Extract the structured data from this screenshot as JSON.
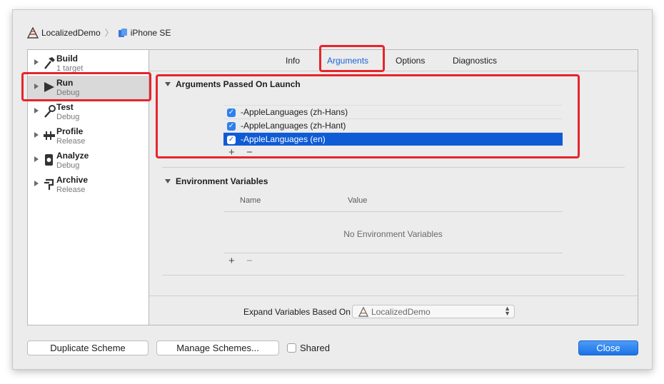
{
  "breadcrumb": {
    "project": "LocalizedDemo",
    "device": "iPhone SE"
  },
  "sidebar": {
    "items": [
      {
        "name": "Build",
        "sub": "1 target",
        "icon": "hammer-icon"
      },
      {
        "name": "Run",
        "sub": "Debug",
        "icon": "play-icon",
        "selected": true
      },
      {
        "name": "Test",
        "sub": "Debug",
        "icon": "wrench-icon"
      },
      {
        "name": "Profile",
        "sub": "Release",
        "icon": "gauge-icon"
      },
      {
        "name": "Analyze",
        "sub": "Debug",
        "icon": "analyze-icon"
      },
      {
        "name": "Archive",
        "sub": "Release",
        "icon": "archive-icon"
      }
    ]
  },
  "tabs": [
    "Info",
    "Arguments",
    "Options",
    "Diagnostics"
  ],
  "active_tab": "Arguments",
  "arguments": {
    "title": "Arguments Passed On Launch",
    "items": [
      {
        "label": "-AppleLanguages (zh-Hans)",
        "checked": true
      },
      {
        "label": "-AppleLanguages (zh-Hant)",
        "checked": true
      },
      {
        "label": "-AppleLanguages (en)",
        "checked": true,
        "selected": true
      }
    ],
    "add": "+",
    "remove": "−"
  },
  "environment": {
    "title": "Environment Variables",
    "col_name": "Name",
    "col_value": "Value",
    "empty": "No Environment Variables",
    "add": "+",
    "remove": "−"
  },
  "expand": {
    "label": "Expand Variables Based On",
    "value": "LocalizedDemo"
  },
  "footer": {
    "duplicate": "Duplicate Scheme",
    "manage": "Manage Schemes...",
    "shared": "Shared",
    "close": "Close"
  },
  "colors": {
    "accent": "#1a64d4",
    "selection": "#0f5bd6",
    "highlight": "#e6252b"
  }
}
